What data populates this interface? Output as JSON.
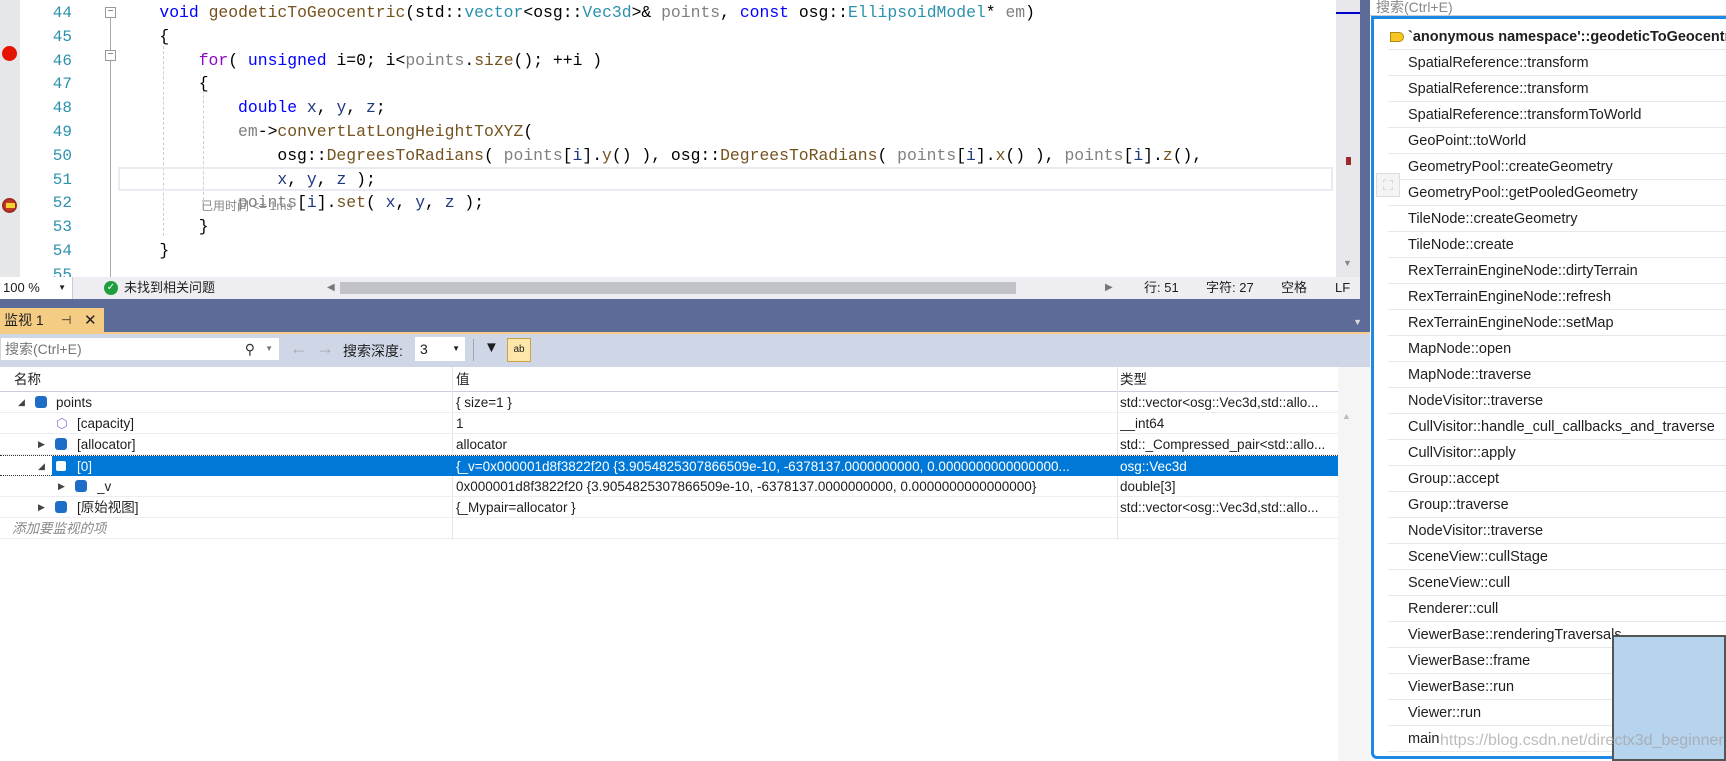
{
  "editor": {
    "line_numbers": [
      "44",
      "45",
      "46",
      "47",
      "48",
      "49",
      "50",
      "51",
      "52",
      "53",
      "54",
      "55"
    ],
    "inline_hint": "已用时间 <= 1ms"
  },
  "code_lines": [
    [
      [
        "    ",
        ""
      ],
      [
        "void",
        "kw"
      ],
      [
        " ",
        ""
      ],
      [
        "geodeticToGeocentric",
        "fn"
      ],
      [
        "(std::",
        ""
      ],
      [
        "vector",
        "ty"
      ],
      [
        "<osg::",
        ""
      ],
      [
        "Vec3d",
        "ty"
      ],
      [
        ">& ",
        ""
      ],
      [
        "points",
        "pa"
      ],
      [
        ", ",
        ""
      ],
      [
        "const",
        "kw"
      ],
      [
        " osg::",
        ""
      ],
      [
        "EllipsoidModel",
        "ty"
      ],
      [
        "* ",
        ""
      ],
      [
        "em",
        "pa"
      ],
      [
        ")",
        ""
      ]
    ],
    [
      [
        "    {",
        ""
      ]
    ],
    [
      [
        "        ",
        ""
      ],
      [
        "for",
        "ctl"
      ],
      [
        "( ",
        ""
      ],
      [
        "unsigned",
        "kw"
      ],
      [
        " i=0; i<",
        ""
      ],
      [
        "points",
        "pa"
      ],
      [
        ".",
        ""
      ],
      [
        "size",
        "fn"
      ],
      [
        "(); ++i )",
        ""
      ]
    ],
    [
      [
        "        {",
        ""
      ]
    ],
    [
      [
        "            ",
        ""
      ],
      [
        "double",
        "kw"
      ],
      [
        " ",
        ""
      ],
      [
        "x",
        "lv"
      ],
      [
        ", ",
        ""
      ],
      [
        "y",
        "lv"
      ],
      [
        ", ",
        ""
      ],
      [
        "z",
        "lv"
      ],
      [
        ";",
        ""
      ]
    ],
    [
      [
        "            ",
        ""
      ],
      [
        "em",
        "pa"
      ],
      [
        "->",
        ""
      ],
      [
        "convertLatLongHeightToXYZ",
        "fn"
      ],
      [
        "(",
        ""
      ]
    ],
    [
      [
        "                osg::",
        ""
      ],
      [
        "DegreesToRadians",
        "fn"
      ],
      [
        "( ",
        ""
      ],
      [
        "points",
        "pa"
      ],
      [
        "[",
        ""
      ],
      [
        "i",
        "lv"
      ],
      [
        "].",
        ""
      ],
      [
        "y",
        "fn"
      ],
      [
        "() ), osg::",
        ""
      ],
      [
        "DegreesToRadians",
        "fn"
      ],
      [
        "( ",
        ""
      ],
      [
        "points",
        "pa"
      ],
      [
        "[",
        ""
      ],
      [
        "i",
        "lv"
      ],
      [
        "].",
        ""
      ],
      [
        "x",
        "fn"
      ],
      [
        "() ), ",
        ""
      ],
      [
        "points",
        "pa"
      ],
      [
        "[",
        ""
      ],
      [
        "i",
        "lv"
      ],
      [
        "].",
        ""
      ],
      [
        "z",
        "fn"
      ],
      [
        "(),",
        ""
      ]
    ],
    [
      [
        "                ",
        ""
      ],
      [
        "x",
        "lv"
      ],
      [
        ", ",
        ""
      ],
      [
        "y",
        "lv"
      ],
      [
        ", ",
        ""
      ],
      [
        "z",
        "lv"
      ],
      [
        " );",
        ""
      ]
    ],
    [
      [
        "            ",
        ""
      ],
      [
        "points",
        "pa"
      ],
      [
        "[",
        ""
      ],
      [
        "i",
        "lv"
      ],
      [
        "].",
        ""
      ],
      [
        "set",
        "fn"
      ],
      [
        "( ",
        ""
      ],
      [
        "x",
        "lv"
      ],
      [
        ", ",
        ""
      ],
      [
        "y",
        "lv"
      ],
      [
        ", ",
        ""
      ],
      [
        "z",
        "lv"
      ],
      [
        " );",
        ""
      ]
    ],
    [
      [
        "        }",
        ""
      ]
    ],
    [
      [
        "    }",
        ""
      ]
    ],
    [
      [
        "",
        ""
      ]
    ]
  ],
  "statusbar": {
    "zoom": "100 %",
    "issues": "未找到相关问题",
    "line": "行: 51",
    "char": "字符: 27",
    "spaces": "空格",
    "eol": "LF"
  },
  "watch": {
    "tab_title": "监视 1",
    "search_placeholder": "搜索(Ctrl+E)",
    "depth_label": "搜索深度:",
    "depth_value": "3",
    "columns": [
      "名称",
      "值",
      "类型"
    ],
    "rows": [
      {
        "name": "points",
        "value": "{ size=1 }",
        "type": "std::vector<osg::Vec3d,std::allo..."
      },
      {
        "name": "[capacity]",
        "value": "1",
        "type": "__int64"
      },
      {
        "name": "[allocator]",
        "value": "allocator",
        "type": "std::_Compressed_pair<std::allo..."
      },
      {
        "name": "[0]",
        "value": "{_v=0x000001d8f3822f20 {3.9054825307866509e-10, -6378137.0000000000, 0.0000000000000000...",
        "type": "osg::Vec3d"
      },
      {
        "name": "_v",
        "value": "0x000001d8f3822f20 {3.9054825307866509e-10, -6378137.0000000000, 0.0000000000000000}",
        "type": "double[3]"
      },
      {
        "name": "[原始视图]",
        "value": "{_Mypair=allocator }",
        "type": "std::vector<osg::Vec3d,std::allo..."
      }
    ],
    "add_placeholder": "添加要监视的项"
  },
  "callstack": {
    "search_placeholder": "搜索(Ctrl+E)",
    "frames": [
      "`anonymous namespace'::geodeticToGeocentric",
      "SpatialReference::transform",
      "SpatialReference::transform",
      "SpatialReference::transformToWorld",
      "GeoPoint::toWorld",
      "GeometryPool::createGeometry",
      "GeometryPool::getPooledGeometry",
      "TileNode::createGeometry",
      "TileNode::create",
      "RexTerrainEngineNode::dirtyTerrain",
      "RexTerrainEngineNode::refresh",
      "RexTerrainEngineNode::setMap",
      "MapNode::open",
      "MapNode::traverse",
      "NodeVisitor::traverse",
      "CullVisitor::handle_cull_callbacks_and_traverse",
      "CullVisitor::apply",
      "Group::accept",
      "Group::traverse",
      "NodeVisitor::traverse",
      "SceneView::cullStage",
      "SceneView::cull",
      "Renderer::cull",
      "ViewerBase::renderingTraversals",
      "ViewerBase::frame",
      "ViewerBase::run",
      "Viewer::run",
      "main"
    ]
  },
  "watermark": "https://blog.csdn.net/directx3d_beginner",
  "colors": {
    "selection": "#0078d7",
    "accent_band": "#5d6b99",
    "tab": "#f5cc84",
    "breakpoint": "#e51400"
  }
}
